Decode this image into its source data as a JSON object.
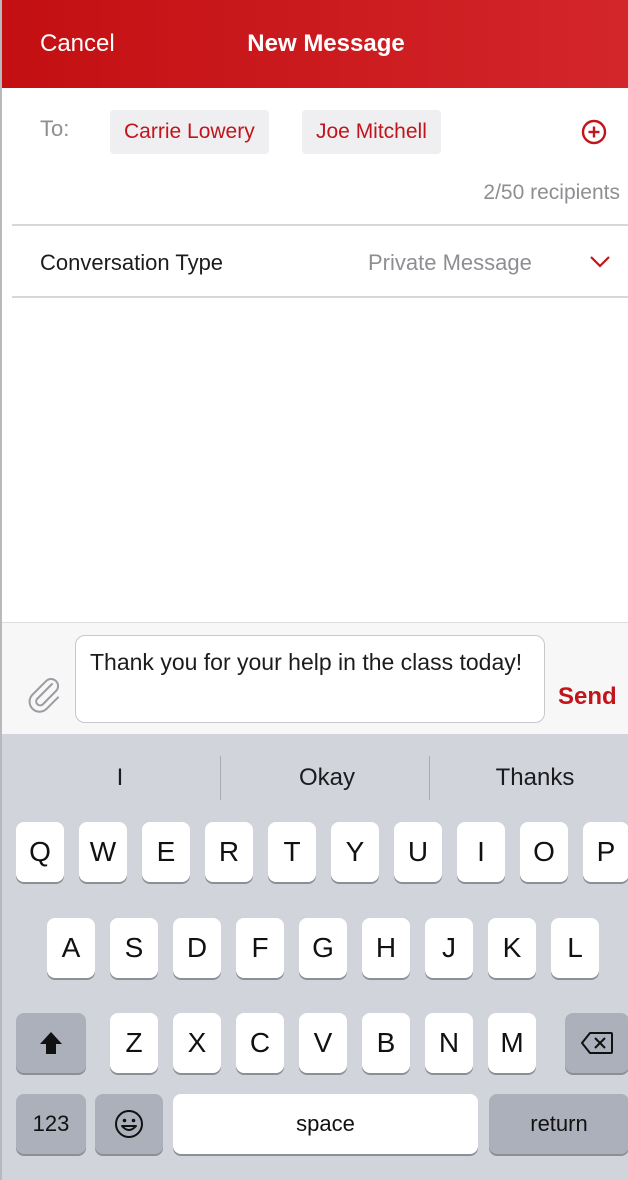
{
  "header": {
    "cancel_label": "Cancel",
    "title": "New Message"
  },
  "recipients": {
    "to_label": "To:",
    "chips": [
      "Carrie Lowery",
      "Joe Mitchell"
    ],
    "count_text": "2/50 recipients",
    "add_icon": "plus-circle-icon"
  },
  "conversation": {
    "label": "Conversation Type",
    "value": "Private Message",
    "chevron_icon": "chevron-down-icon"
  },
  "composer": {
    "attach_icon": "paperclip-icon",
    "message_text": "Thank you for your help in the class today!",
    "send_label": "Send"
  },
  "keyboard": {
    "suggestions": [
      "I",
      "Okay",
      "Thanks"
    ],
    "row1": [
      "Q",
      "W",
      "E",
      "R",
      "T",
      "Y",
      "U",
      "I",
      "O",
      "P"
    ],
    "row2": [
      "A",
      "S",
      "D",
      "F",
      "G",
      "H",
      "J",
      "K",
      "L"
    ],
    "row3": [
      "Z",
      "X",
      "C",
      "V",
      "B",
      "N",
      "M"
    ],
    "numbers_label": "123",
    "space_label": "space",
    "return_label": "return",
    "shift_icon": "shift-icon",
    "backspace_icon": "backspace-icon",
    "emoji_icon": "emoji-icon"
  },
  "colors": {
    "accent": "#c1151c",
    "header_bg": "#c30f12",
    "keyboard_bg": "#d1d4da"
  }
}
